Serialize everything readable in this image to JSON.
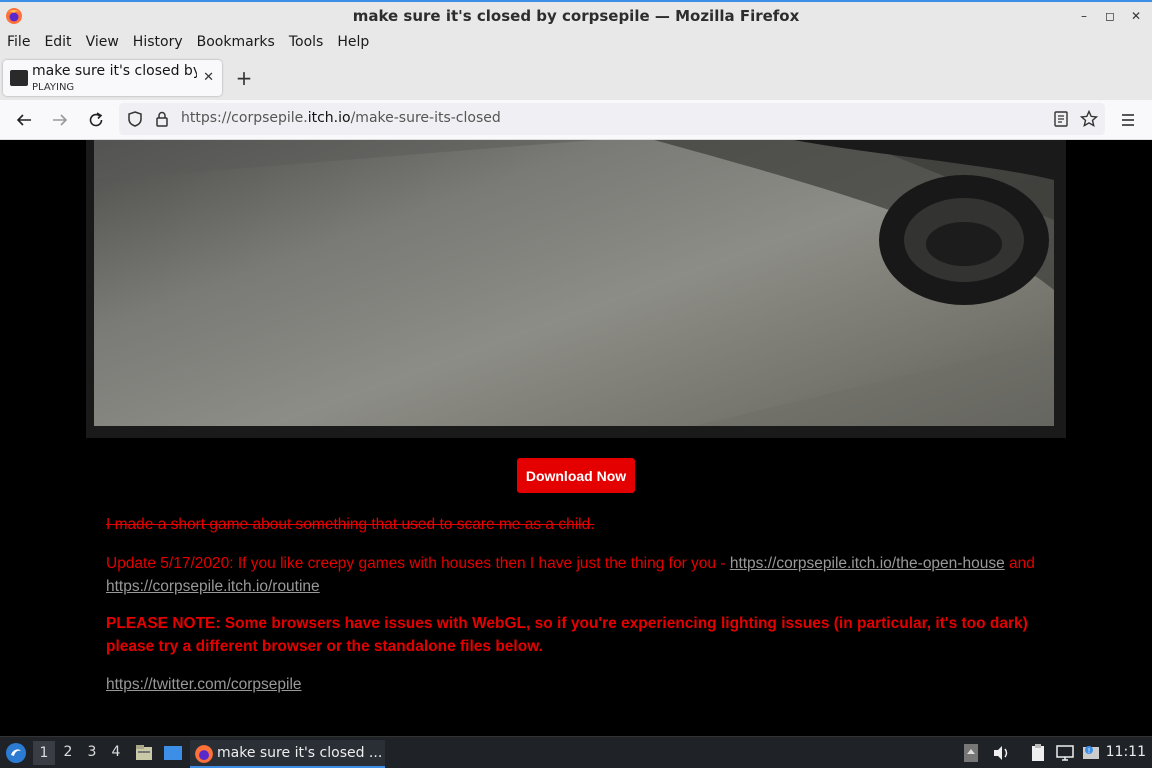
{
  "window": {
    "title": "make sure it's closed by corpsepile — Mozilla Firefox"
  },
  "menu": [
    "File",
    "Edit",
    "View",
    "History",
    "Bookmarks",
    "Tools",
    "Help"
  ],
  "tab": {
    "title": "make sure it's closed by",
    "subtitle": "PLAYING"
  },
  "url": {
    "prefix": "https://corpsepile.",
    "domain": "itch.io",
    "path": "/make-sure-its-closed"
  },
  "content": {
    "download_label": "Download Now",
    "strike_line": "I made a short game about something that used to scare me as a child.",
    "update_text": "Update 5/17/2020: If you like creepy games with houses then I have just the thing for you - ",
    "update_link1": "https://corpsepile.itch.io/the-open-house",
    "update_and": " and ",
    "update_link2": "https://corpsepile.itch.io/routine",
    "note": "PLEASE NOTE: Some browsers have issues with WebGL, so if you're experiencing lighting issues (in particular, it's too dark) please try a different browser or the standalone files below.",
    "twitter": "https://twitter.com/corpsepile"
  },
  "taskbar": {
    "workspaces": [
      "1",
      "2",
      "3",
      "4"
    ],
    "task_label": "make sure it's closed ...",
    "clock": "11:11"
  },
  "icons": {
    "back": "back-arrow-icon",
    "forward": "forward-arrow-icon",
    "reload": "reload-icon",
    "shield": "shield-icon",
    "lock": "lock-icon",
    "reader": "reader-view-icon",
    "star": "bookmark-star-icon",
    "menu": "hamburger-menu-icon"
  },
  "colors": {
    "accent": "#3c8ee6",
    "download_button": "#e40000",
    "page_text": "#e40000",
    "link": "#999999"
  }
}
